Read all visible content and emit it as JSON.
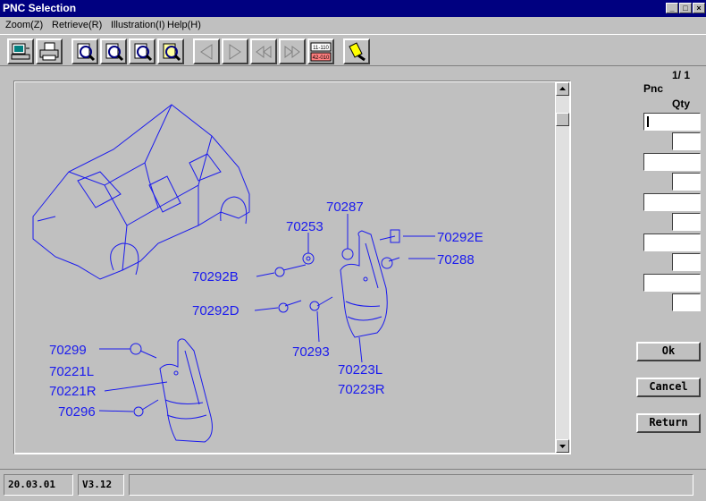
{
  "window": {
    "title": "PNC Selection"
  },
  "menu": [
    {
      "label": "Zoom(Z)"
    },
    {
      "label": "Retrieve(R)"
    },
    {
      "label": "Illustration(I)"
    },
    {
      "label": "Help(H)"
    }
  ],
  "toolbar": {
    "icons": [
      "computer-icon",
      "printer-icon",
      "zoom-doc-icon-1",
      "zoom-doc-icon-2",
      "zoom-doc-icon-3",
      "zoom-doc-icon-4",
      "prev-arrow-icon",
      "next-arrow-icon",
      "first-page-icon",
      "last-page-icon",
      "group-code-icon",
      "flashlight-icon"
    ],
    "group_code_top": "11-110",
    "group_code_bottom": "42-010"
  },
  "page_indicator": "1/ 1",
  "side_panel": {
    "pnc_label": "Pnc",
    "qty_label": "Qty"
  },
  "buttons": {
    "ok": "Ok",
    "cancel": "Cancel",
    "return": "Return"
  },
  "diagram": {
    "callouts": [
      "70287",
      "70253",
      "70292E",
      "70292B",
      "70288",
      "70292D",
      "70293",
      "70223L",
      "70223R",
      "70299",
      "70221L",
      "70221R",
      "70296"
    ]
  },
  "status": {
    "date": "20.03.01",
    "version": "V3.12",
    "message": ""
  },
  "colors": {
    "titlebar": "#000080",
    "callout": "#1a1aee",
    "window_bg": "#c0c0c0"
  }
}
